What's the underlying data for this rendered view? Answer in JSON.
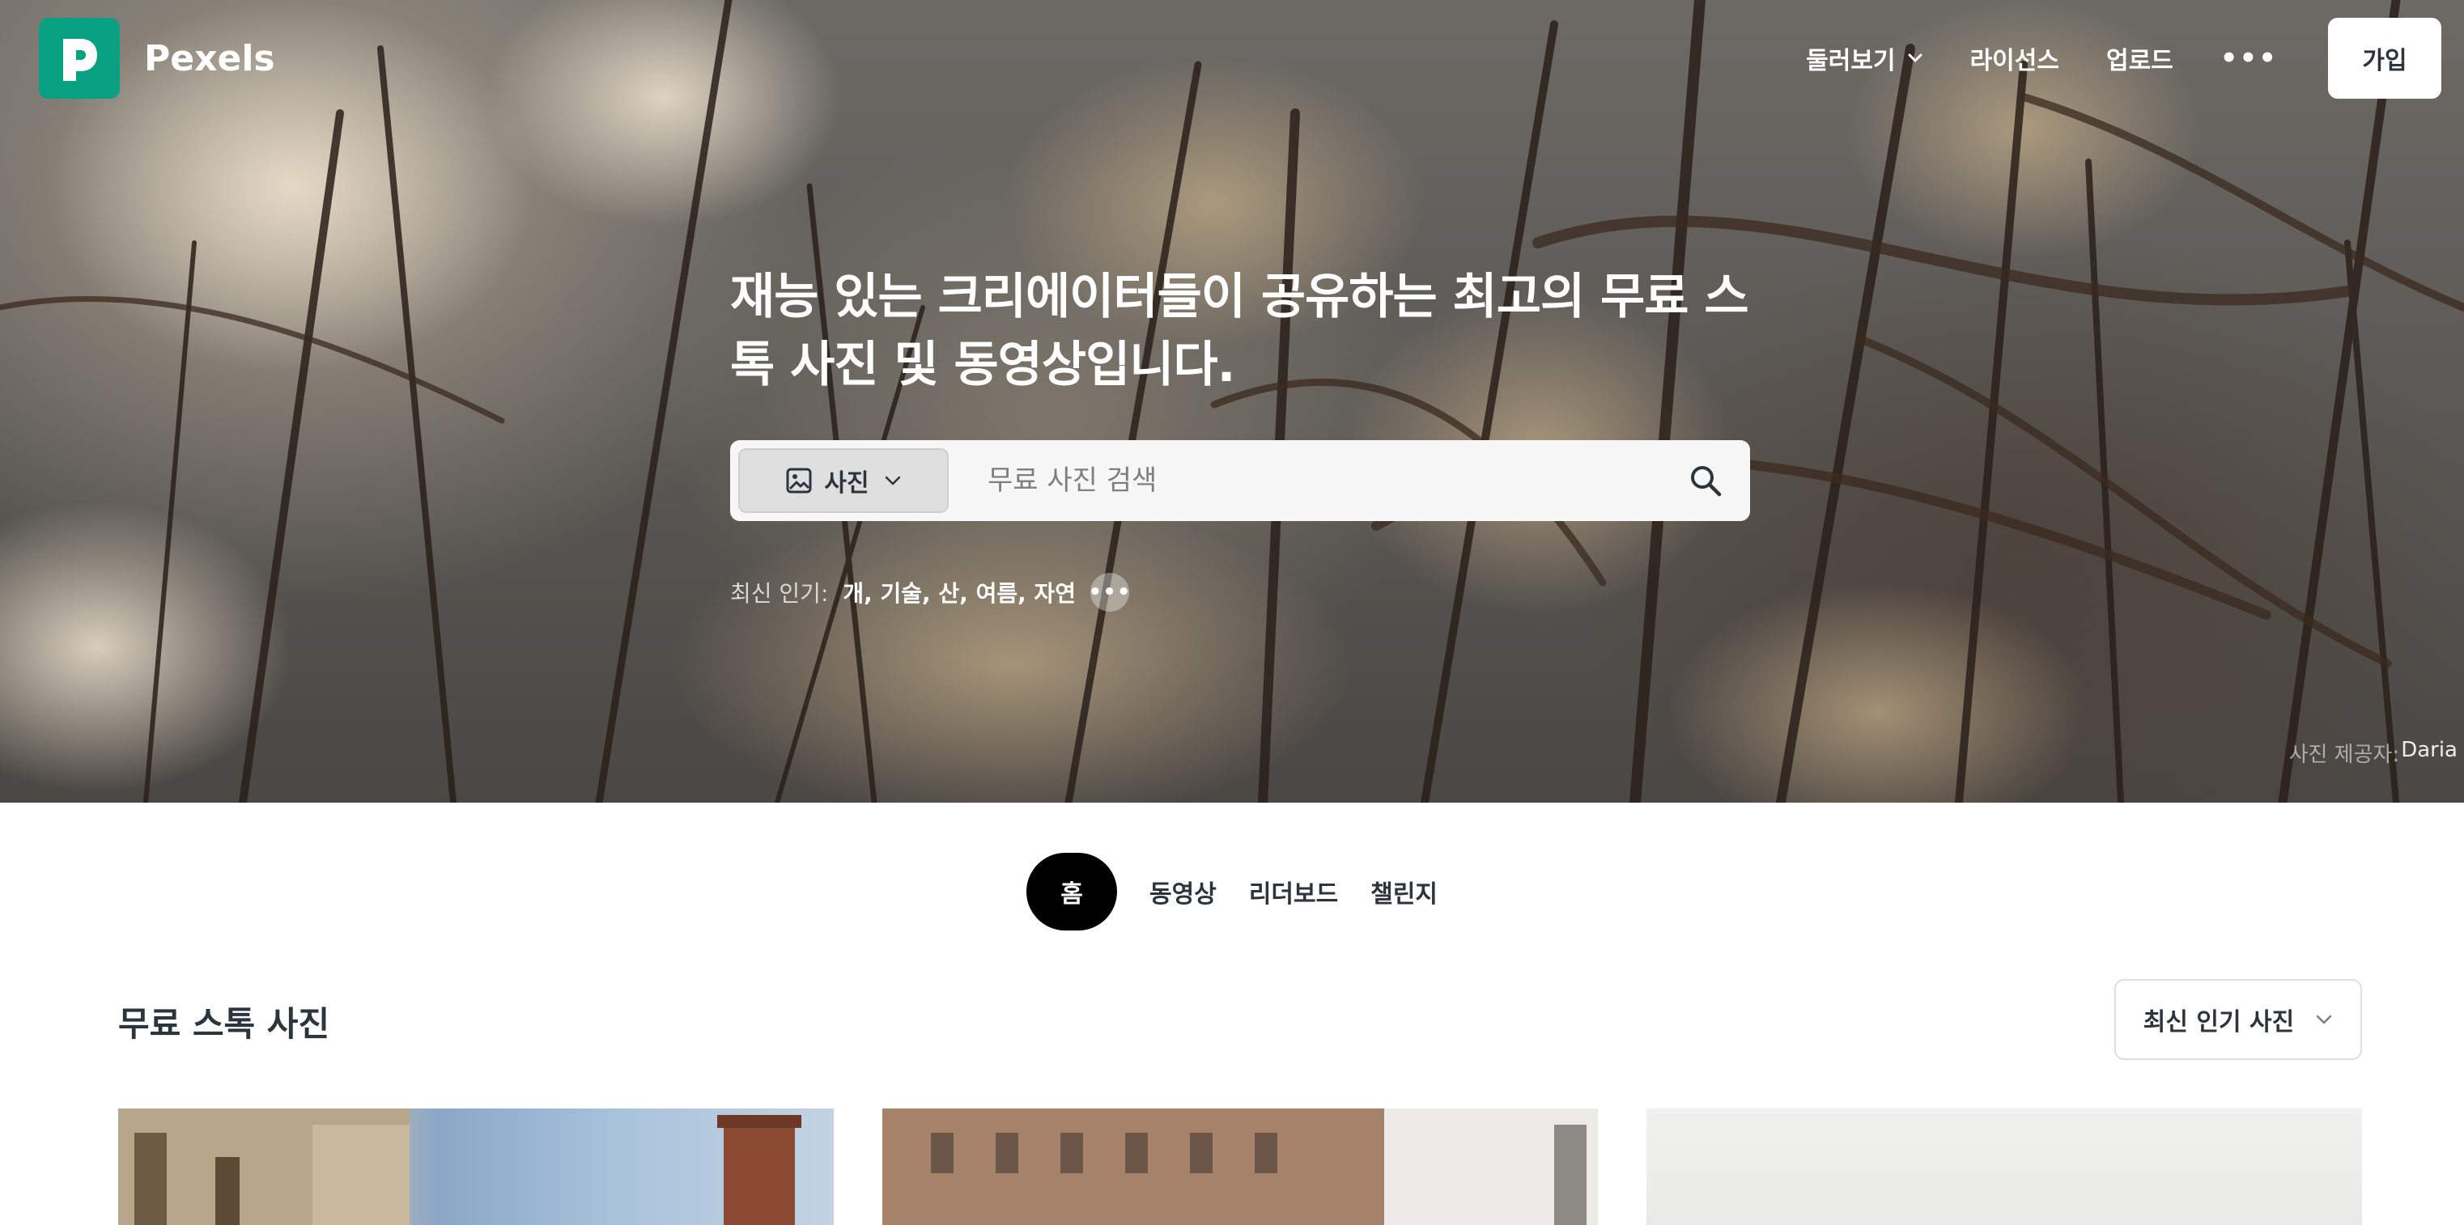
{
  "brand": {
    "name": "Pexels",
    "color": "#07a081"
  },
  "nav": {
    "explore": "둘러보기",
    "license": "라이선스",
    "upload": "업로드",
    "join": "가입"
  },
  "hero": {
    "headline": "재능 있는 크리에이터들이 공유하는 최고의 무료 스톡 사진 및 동영상입니다.",
    "search": {
      "type_label": "사진",
      "placeholder": "무료 사진 검색"
    },
    "trending": {
      "label": "최신 인기:",
      "items": "개, 기술, 산, 여름, 자연"
    },
    "credit": {
      "label": "사진 제공자:",
      "name": "Daria"
    }
  },
  "tabs": [
    {
      "label": "홈",
      "active": true
    },
    {
      "label": "동영상"
    },
    {
      "label": "리더보드"
    },
    {
      "label": "챌린지"
    }
  ],
  "section": {
    "title": "무료 스톡 사진",
    "sort_label": "최신 인기 사진"
  }
}
